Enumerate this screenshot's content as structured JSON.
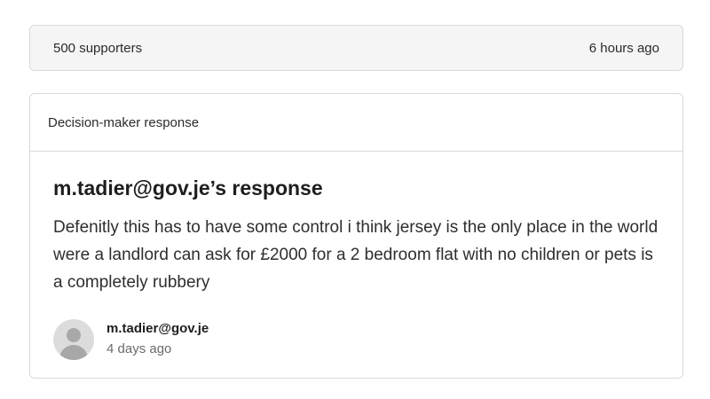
{
  "supporters": {
    "count_label": "500 supporters",
    "time_label": "6 hours ago"
  },
  "response_card": {
    "header": "Decision-maker response",
    "title": "m.tadier@gov.je’s response",
    "text": "Defenitly this has to have some control i think jersey is the only place in the world were a landlord can ask for £2000 for a 2 bedroom flat with no children or pets is a completely rubbery",
    "author": {
      "name": "m.tadier@gov.je",
      "time": "4 days ago",
      "avatar_icon": "user-avatar-icon"
    }
  },
  "colors": {
    "border": "#d9d9dc",
    "bar_background": "#f5f5f6",
    "muted_text": "#6b6b6b"
  }
}
